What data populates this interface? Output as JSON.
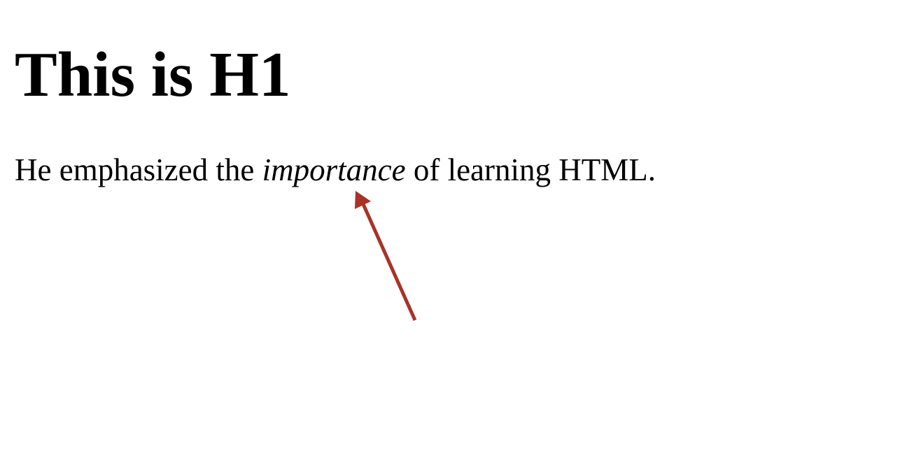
{
  "heading": "This is H1",
  "paragraph": {
    "before": "He emphasized the ",
    "emphasis": "importance",
    "after": " of learning HTML."
  },
  "annotation": {
    "arrow_color": "#a93226",
    "icon": "arrow-icon"
  }
}
